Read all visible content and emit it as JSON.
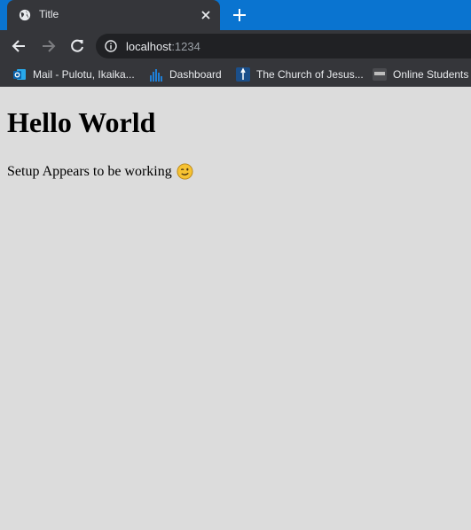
{
  "browser": {
    "tab_title": "Title",
    "url_host": "localhost",
    "url_port": ":1234",
    "colors": {
      "tabstrip": "#0a74d0",
      "chrome": "#35363a",
      "omnibox": "#202124",
      "text": "#e8eaed"
    }
  },
  "bookmarks": [
    {
      "label": "Mail - Pulotu, Ikaika...",
      "icon": "outlook-icon"
    },
    {
      "label": "Dashboard",
      "icon": "dashboard-bars-icon"
    },
    {
      "label": "The Church of Jesus...",
      "icon": "church-icon"
    },
    {
      "label": "Online Students",
      "icon": "byu-icon"
    }
  ],
  "page": {
    "heading": "Hello World",
    "message": "Setup Appears to be working",
    "emoji": "winking-face-icon",
    "background": "#dcdcdc"
  }
}
